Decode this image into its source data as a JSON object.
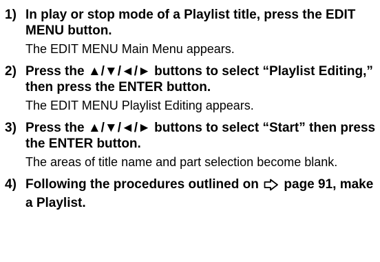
{
  "steps": [
    {
      "number": "1)",
      "title": "In play or stop mode of a Playlist title, press the EDIT MENU button.",
      "description": "The EDIT MENU Main Menu appears."
    },
    {
      "number": "2)",
      "title": "Press the ▲/▼/◄/► buttons to select “Playlist Editing,” then press the ENTER button.",
      "description": "The EDIT MENU Playlist Editing appears."
    },
    {
      "number": "3)",
      "title": "Press the ▲/▼/◄/► buttons to select “Start” then press the ENTER button.",
      "description": "The areas of title name and part selection become blank."
    },
    {
      "number": "4)",
      "title_before_icon": "Following the procedures outlined on",
      "title_after_icon": "page 91, make a Playlist.",
      "icon": "page-reference-arrow-icon"
    }
  ]
}
